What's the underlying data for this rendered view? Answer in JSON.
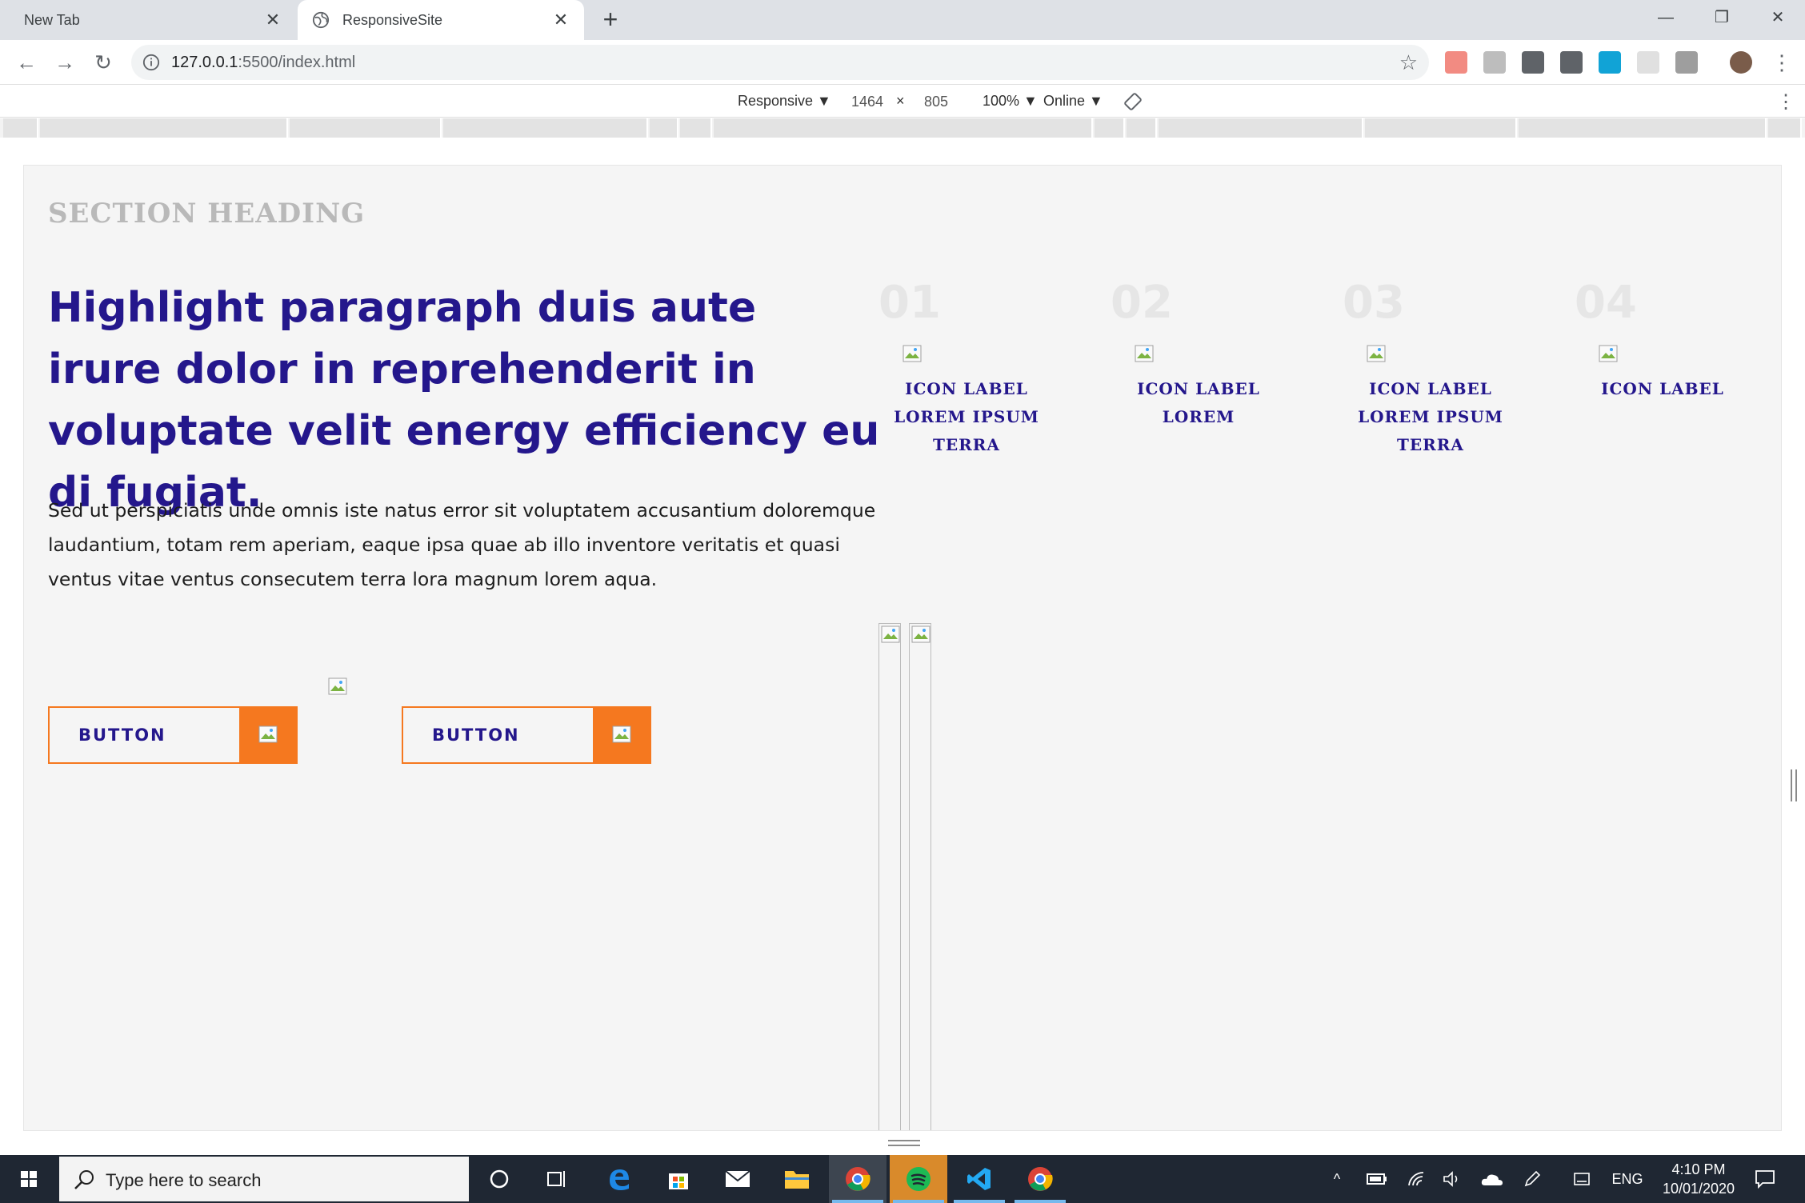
{
  "browser": {
    "tabs": [
      {
        "title": "New Tab"
      },
      {
        "title": "ResponsiveSite"
      }
    ],
    "close_glyph": "✕",
    "new_tab_glyph": "+",
    "window_controls": {
      "minimize": "—",
      "restore": "❐",
      "close": "✕"
    },
    "nav": {
      "back": "←",
      "forward": "→",
      "reload": "↻"
    },
    "url_host": "127.0.0.1",
    "url_rest": ":5500/index.html",
    "bookmark_glyph": "☆",
    "menu_glyph": "⋮",
    "extensions": [
      {
        "name": "extension-red-icon",
        "color": "#f28b82"
      },
      {
        "name": "extension-gray-icon",
        "color": "#bdbdbd"
      },
      {
        "name": "extension-code-icon",
        "color": "#5f6368"
      },
      {
        "name": "extension-head-icon",
        "color": "#5f6368"
      },
      {
        "name": "extension-grammarly-icon",
        "color": "#11a3d6"
      },
      {
        "name": "extension-blank-icon",
        "color": "#e0e0e0"
      },
      {
        "name": "extension-v-icon",
        "color": "#9e9e9e"
      },
      {
        "name": "profile-avatar",
        "color": "#7a5c4a"
      }
    ]
  },
  "devtools": {
    "device": "Responsive ▼",
    "width": "1464",
    "times": "×",
    "height": "805",
    "zoom": "100% ▼",
    "network": "Online ▼",
    "menu_glyph": "⋮"
  },
  "page": {
    "section_heading": "SECTION HEADING",
    "highlight": "Highlight paragraph duis aute irure dolor in reprehenderit in voluptate velit energy efficiency eu di fugiat.",
    "body": "Sed ut perspiciatis unde omnis iste natus error sit voluptatem accusantium doloremque laudantium, totam rem aperiam, eaque ipsa quae ab illo inventore veritatis et quasi ventus vitae ventus consecutem terra lora magnum lorem aqua.",
    "buttons": [
      {
        "label": "BUTTON"
      },
      {
        "label": "BUTTON"
      }
    ],
    "features": [
      {
        "number": "01",
        "label": "ICON LABEL LOREM IPSUM TERRA"
      },
      {
        "number": "02",
        "label": "ICON LABEL LOREM"
      },
      {
        "number": "03",
        "label": "ICON LABEL LOREM IPSUM TERRA"
      },
      {
        "number": "04",
        "label": "ICON LABEL"
      }
    ],
    "colors": {
      "accent": "#f5781f",
      "heading": "#24178c",
      "muted": "#b9b9b9",
      "background": "#f5f5f5"
    }
  },
  "taskbar": {
    "search_placeholder": "Type here to search",
    "language": "ENG",
    "time": "4:10 PM",
    "date": "10/01/2020",
    "tray_chevron": "^"
  }
}
